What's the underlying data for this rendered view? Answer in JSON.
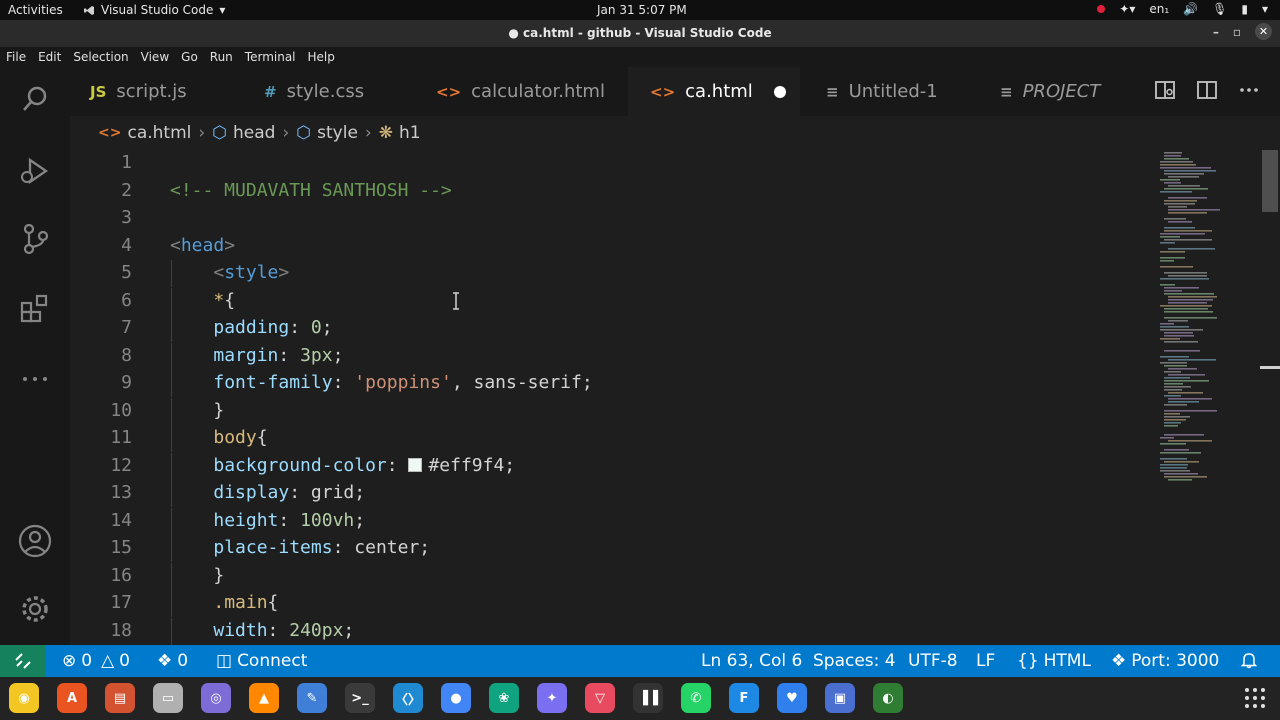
{
  "system_bar": {
    "activities": "Activities",
    "app_name": "Visual Studio Code",
    "clock": "Jan 31  5:07 PM",
    "keyboard": "en₁"
  },
  "window": {
    "title": "● ca.html - github - Visual Studio Code"
  },
  "menu": [
    "File",
    "Edit",
    "Selection",
    "View",
    "Go",
    "Run",
    "Terminal",
    "Help"
  ],
  "tabs": [
    {
      "icon_text": "JS",
      "label": "script.js",
      "icon": "js-file-icon",
      "color": "#cbcb41"
    },
    {
      "icon_text": "#",
      "label": "style.css",
      "icon": "css-file-icon",
      "color": "#519aba"
    },
    {
      "icon_text": "<>",
      "label": "calculator.html",
      "icon": "html-file-icon",
      "color": "#e37933"
    },
    {
      "icon_text": "<>",
      "label": "ca.html",
      "icon": "html-file-icon",
      "color": "#e37933",
      "active": true,
      "modified": true
    },
    {
      "icon_text": "≡",
      "label": "Untitled-1",
      "icon": "text-file-icon",
      "color": "#9a9a9a"
    },
    {
      "icon_text": "≡",
      "label": "PROJECT",
      "icon": "text-file-icon",
      "color": "#9a9a9a",
      "italic": true
    }
  ],
  "breadcrumb": {
    "file": "ca.html",
    "items": [
      "head",
      "style",
      "h1"
    ]
  },
  "editor": {
    "lines": [
      {
        "n": "1",
        "tokens": []
      },
      {
        "n": "2",
        "tokens": [
          {
            "t": "<!-- MUDAVATH SANTHOSH -->",
            "c": "comment"
          }
        ]
      },
      {
        "n": "3",
        "tokens": []
      },
      {
        "n": "4",
        "tokens": [
          {
            "t": "<",
            "c": "punct"
          },
          {
            "t": "head",
            "c": "tag"
          },
          {
            "t": ">",
            "c": "punct"
          }
        ]
      },
      {
        "n": "5",
        "tokens": [
          {
            "t": "    ",
            "c": "plain"
          },
          {
            "t": "<",
            "c": "punct"
          },
          {
            "t": "style",
            "c": "tag"
          },
          {
            "t": ">",
            "c": "punct"
          }
        ]
      },
      {
        "n": "6",
        "tokens": [
          {
            "t": "    ",
            "c": "plain"
          },
          {
            "t": "*",
            "c": "sel"
          },
          {
            "t": "{",
            "c": "plain"
          }
        ]
      },
      {
        "n": "7",
        "tokens": [
          {
            "t": "    ",
            "c": "plain"
          },
          {
            "t": "padding",
            "c": "prop"
          },
          {
            "t": ": ",
            "c": "plain"
          },
          {
            "t": "0",
            "c": "num"
          },
          {
            "t": ";",
            "c": "plain"
          }
        ]
      },
      {
        "n": "8",
        "tokens": [
          {
            "t": "    ",
            "c": "plain"
          },
          {
            "t": "margin",
            "c": "prop"
          },
          {
            "t": ": ",
            "c": "plain"
          },
          {
            "t": "3px",
            "c": "num"
          },
          {
            "t": ";",
            "c": "plain"
          }
        ]
      },
      {
        "n": "9",
        "tokens": [
          {
            "t": "    ",
            "c": "plain"
          },
          {
            "t": "font-family",
            "c": "prop"
          },
          {
            "t": ": ",
            "c": "plain"
          },
          {
            "t": "'poppins'",
            "c": "str"
          },
          {
            "t": ", sans-serif;",
            "c": "plain"
          }
        ]
      },
      {
        "n": "10",
        "tokens": [
          {
            "t": "    ",
            "c": "plain"
          },
          {
            "t": "}",
            "c": "plain"
          }
        ]
      },
      {
        "n": "11",
        "tokens": [
          {
            "t": "    ",
            "c": "plain"
          },
          {
            "t": "body",
            "c": "sel"
          },
          {
            "t": "{",
            "c": "plain"
          }
        ]
      },
      {
        "n": "12",
        "tokens": [
          {
            "t": "    ",
            "c": "plain"
          },
          {
            "t": "background-color",
            "c": "prop"
          },
          {
            "t": ": ",
            "c": "plain"
          },
          {
            "t": "",
            "c": "swatch"
          },
          {
            "t": "#eff9f4",
            "c": "plain"
          },
          {
            "t": ";",
            "c": "plain"
          }
        ]
      },
      {
        "n": "13",
        "tokens": [
          {
            "t": "    ",
            "c": "plain"
          },
          {
            "t": "display",
            "c": "prop"
          },
          {
            "t": ": ",
            "c": "plain"
          },
          {
            "t": "grid",
            "c": "plain"
          },
          {
            "t": ";",
            "c": "plain"
          }
        ]
      },
      {
        "n": "14",
        "tokens": [
          {
            "t": "    ",
            "c": "plain"
          },
          {
            "t": "height",
            "c": "prop"
          },
          {
            "t": ": ",
            "c": "plain"
          },
          {
            "t": "100vh",
            "c": "num"
          },
          {
            "t": ";",
            "c": "plain"
          }
        ]
      },
      {
        "n": "15",
        "tokens": [
          {
            "t": "    ",
            "c": "plain"
          },
          {
            "t": "place-items",
            "c": "prop"
          },
          {
            "t": ": ",
            "c": "plain"
          },
          {
            "t": "center",
            "c": "plain"
          },
          {
            "t": ";",
            "c": "plain"
          }
        ]
      },
      {
        "n": "16",
        "tokens": [
          {
            "t": "    ",
            "c": "plain"
          },
          {
            "t": "}",
            "c": "plain"
          }
        ]
      },
      {
        "n": "17",
        "tokens": [
          {
            "t": "    ",
            "c": "plain"
          },
          {
            "t": ".main",
            "c": "sel"
          },
          {
            "t": "{",
            "c": "plain"
          }
        ]
      },
      {
        "n": "18",
        "tokens": [
          {
            "t": "    ",
            "c": "plain"
          },
          {
            "t": "width",
            "c": "prop"
          },
          {
            "t": ": ",
            "c": "plain"
          },
          {
            "t": "240px",
            "c": "num"
          },
          {
            "t": ";",
            "c": "plain"
          }
        ]
      }
    ]
  },
  "status_bar": {
    "errors": "0",
    "warnings": "0",
    "ports": "0",
    "connect": "Connect",
    "cursor": "Ln 63, Col 6",
    "spaces": "Spaces: 4",
    "encoding": "UTF-8",
    "eol": "LF",
    "language": "HTML",
    "port": "Port: 3000"
  },
  "dock": {
    "apps": [
      {
        "name": "rhythmbox",
        "color": "#f3c623",
        "glyph": "◉"
      },
      {
        "name": "app-center",
        "color": "#e95420",
        "glyph": "A"
      },
      {
        "name": "libreoffice-impress",
        "color": "#d35230",
        "glyph": "▤"
      },
      {
        "name": "files",
        "color": "#b0b0b0",
        "glyph": "▭"
      },
      {
        "name": "screenshot",
        "color": "#7d6bd6",
        "glyph": "◎"
      },
      {
        "name": "vlc",
        "color": "#ff8800",
        "glyph": "▲"
      },
      {
        "name": "text-editor",
        "color": "#3f7fd7",
        "glyph": "✎"
      },
      {
        "name": "terminal",
        "color": "#3a3a3a",
        "glyph": ">_"
      },
      {
        "name": "vscode",
        "color": "#1f8ad2",
        "glyph": "〈〉"
      },
      {
        "name": "chrome",
        "color": "#4285f4",
        "glyph": "●"
      },
      {
        "name": "chatgpt",
        "color": "#10a37f",
        "glyph": "❀"
      },
      {
        "name": "gemini",
        "color": "#7a6ff0",
        "glyph": "✦"
      },
      {
        "name": "vivaldi",
        "color": "#e84a5f",
        "glyph": "▽"
      },
      {
        "name": "audio-app",
        "color": "#333333",
        "glyph": "▐▐"
      },
      {
        "name": "whatsapp",
        "color": "#25d366",
        "glyph": "✆"
      },
      {
        "name": "figma-like",
        "color": "#1e88e5",
        "glyph": "F"
      },
      {
        "name": "chat-app",
        "color": "#2f80ed",
        "glyph": "♥"
      },
      {
        "name": "screen-capture",
        "color": "#4a6fd0",
        "glyph": "▣"
      },
      {
        "name": "browser",
        "color": "#2e7d32",
        "glyph": "◐"
      }
    ]
  }
}
